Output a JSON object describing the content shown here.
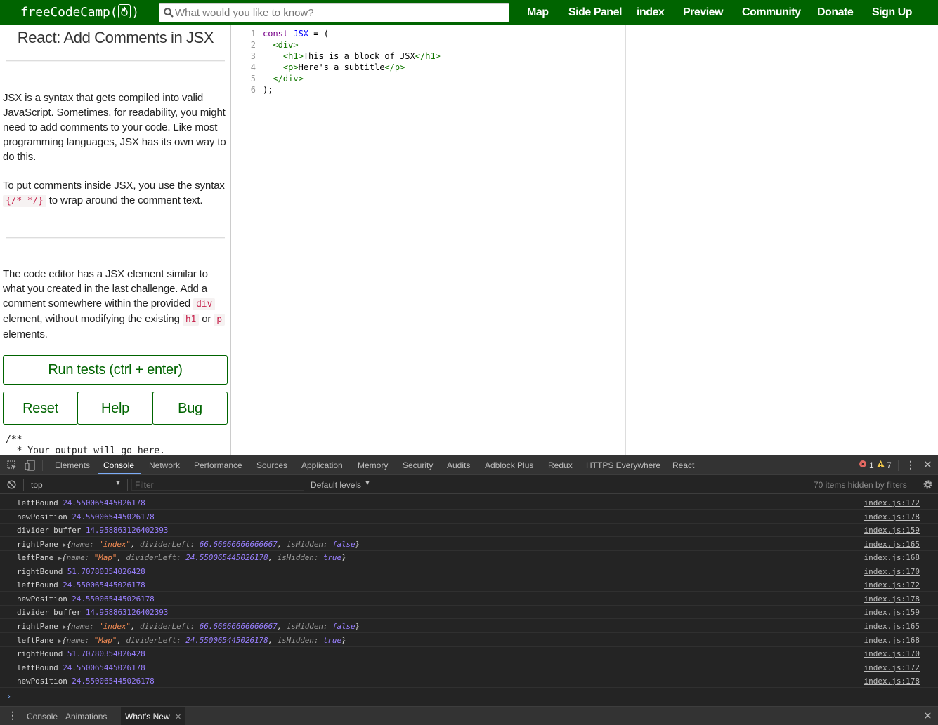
{
  "nav": {
    "logo_text_before": "freeCodeCamp(",
    "logo_text_after": ")",
    "search_placeholder": "What would you like to know?",
    "links": [
      "Map",
      "Side Panel",
      "index",
      "Preview",
      "Community",
      "Donate",
      "Sign Up"
    ]
  },
  "challenge": {
    "title": "React: Add Comments in JSX",
    "p1": "JSX is a syntax that gets compiled into valid JavaScript. Sometimes, for readability, you might need to add comments to your code. Like most programming languages, JSX has its own way to do this.",
    "p2_before": "To put comments inside JSX, you use the syntax",
    "p2_code": "{/* */}",
    "p2_after": "to wrap around the comment text.",
    "p3_a": "The code editor has a JSX element similar to what you created in the last challenge. Add a comment somewhere within the provided",
    "p3_code_div": "div",
    "p3_b": "element, without modifying the existing",
    "p3_code_h1": "h1",
    "p3_c": "or",
    "p3_code_p": "p",
    "p3_d": "elements.",
    "run_label": "Run tests (ctrl + enter)",
    "reset_label": "Reset",
    "help_label": "Help",
    "bug_label": "Bug",
    "output_line1": "/**",
    "output_line2": "  * Your output will go here."
  },
  "editor": {
    "line_numbers": [
      "1",
      "2",
      "3",
      "4",
      "5",
      "6"
    ],
    "code": [
      {
        "kw": "const",
        "def": "JSX",
        "rest": " = ("
      },
      {
        "indent": "  ",
        "tag": "<div>"
      },
      {
        "indent": "    ",
        "tag_open": "<h1>",
        "text": "This is a block of JSX",
        "tag_close": "</h1>"
      },
      {
        "indent": "    ",
        "tag_open": "<p>",
        "text": "Here's a subtitle",
        "tag_close": "</p>"
      },
      {
        "indent": "  ",
        "tag": "</div>"
      },
      {
        "plain": ");"
      }
    ]
  },
  "devtools": {
    "tabs": [
      "Elements",
      "Console",
      "Network",
      "Performance",
      "Sources",
      "Application",
      "Memory",
      "Security",
      "Audits",
      "Adblock Plus",
      "Redux",
      "HTTPS Everywhere",
      "React"
    ],
    "active_tab": "Console",
    "error_count": "1",
    "warning_count": "7",
    "context": "top",
    "filter_placeholder": "Filter",
    "levels": "Default levels",
    "hidden_info": "70 items hidden by filters",
    "rows": [
      {
        "label": "leftBound",
        "value": "24.550065445026178",
        "src": "index.js:172"
      },
      {
        "label": "newPosition",
        "value": "24.550065445026178",
        "src": "index.js:178"
      },
      {
        "label": "divider buffer",
        "value": "14.958863126402393",
        "src": "index.js:159"
      },
      {
        "label": "rightPane",
        "obj": {
          "name": "\"index\"",
          "dividerLeft": "66.66666666666667",
          "isHidden": "false"
        },
        "src": "index.js:165"
      },
      {
        "label": "leftPane",
        "obj": {
          "name": "\"Map\"",
          "dividerLeft": "24.550065445026178",
          "isHidden": "true"
        },
        "src": "index.js:168"
      },
      {
        "label": "rightBound",
        "value": "51.70780354026428",
        "src": "index.js:170"
      },
      {
        "label": "leftBound",
        "value": "24.550065445026178",
        "src": "index.js:172"
      },
      {
        "label": "newPosition",
        "value": "24.550065445026178",
        "src": "index.js:178"
      },
      {
        "label": "divider buffer",
        "value": "14.958863126402393",
        "src": "index.js:159"
      },
      {
        "label": "rightPane",
        "obj": {
          "name": "\"index\"",
          "dividerLeft": "66.66666666666667",
          "isHidden": "false"
        },
        "src": "index.js:165"
      },
      {
        "label": "leftPane",
        "obj": {
          "name": "\"Map\"",
          "dividerLeft": "24.550065445026178",
          "isHidden": "true"
        },
        "src": "index.js:168"
      },
      {
        "label": "rightBound",
        "value": "51.70780354026428",
        "src": "index.js:170"
      },
      {
        "label": "leftBound",
        "value": "24.550065445026178",
        "src": "index.js:172"
      },
      {
        "label": "newPosition",
        "value": "24.550065445026178",
        "src": "index.js:178"
      }
    ],
    "prompt": "›",
    "drawer_tabs": [
      "Console",
      "Animations",
      "What's New"
    ]
  },
  "colors": {
    "brand_green": "#006400",
    "devtools_bg": "#242424",
    "console_number": "#9980ff",
    "console_string": "#f28b54"
  }
}
